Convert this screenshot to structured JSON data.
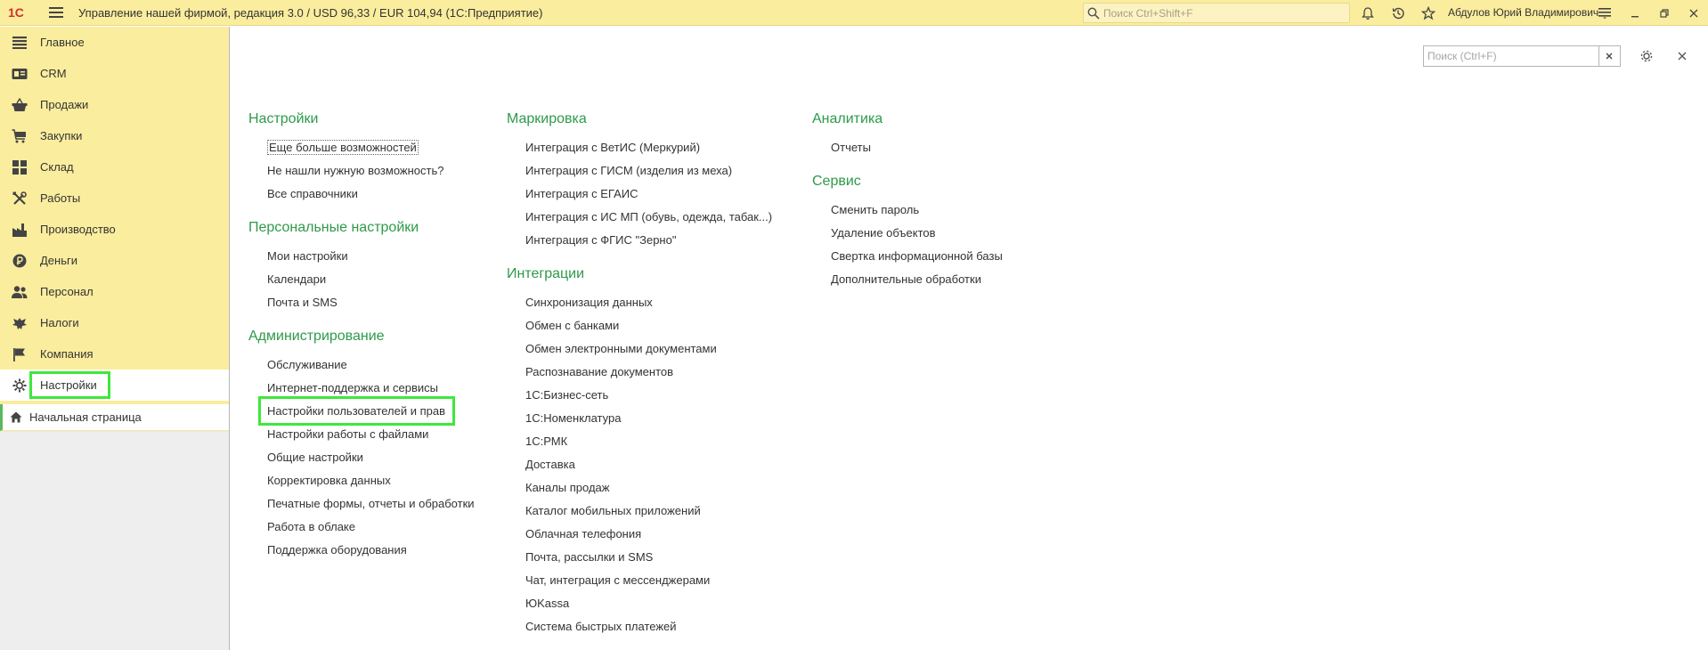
{
  "titlebar": {
    "logo_text": "1С",
    "title": "Управление нашей фирмой, редакция 3.0 / USD 96,33 / EUR 104,94  (1С:Предприятие)",
    "search_placeholder": "Поиск Ctrl+Shift+F",
    "user_name": "Абдулов Юрий Владимирович",
    "icons": [
      "bell-icon",
      "history-icon",
      "star-icon",
      "menu-icon",
      "minimize-icon",
      "restore-icon",
      "close-icon"
    ]
  },
  "sidebar": {
    "items": [
      {
        "label": "Главное",
        "icon": "home-list-icon"
      },
      {
        "label": "CRM",
        "icon": "crm-icon"
      },
      {
        "label": "Продажи",
        "icon": "basket-icon"
      },
      {
        "label": "Закупки",
        "icon": "cart-icon"
      },
      {
        "label": "Склад",
        "icon": "warehouse-icon"
      },
      {
        "label": "Работы",
        "icon": "tools-icon"
      },
      {
        "label": "Производство",
        "icon": "factory-icon"
      },
      {
        "label": "Деньги",
        "icon": "ruble-icon"
      },
      {
        "label": "Персонал",
        "icon": "people-icon"
      },
      {
        "label": "Налоги",
        "icon": "emblem-icon"
      },
      {
        "label": "Компания",
        "icon": "flag-icon"
      },
      {
        "label": "Настройки",
        "icon": "gear-icon",
        "active": true
      }
    ],
    "home_tab": "Начальная страница"
  },
  "main": {
    "search_placeholder": "Поиск (Ctrl+F)",
    "columns": [
      {
        "sections": [
          {
            "title": "Настройки",
            "links": [
              "Еще больше возможностей",
              "Не нашли нужную возможность?",
              "Все справочники"
            ]
          },
          {
            "title": "Персональные настройки",
            "links": [
              "Мои настройки",
              "Календари",
              "Почта и SMS"
            ]
          },
          {
            "title": "Администрирование",
            "links": [
              "Обслуживание",
              "Интернет-поддержка и сервисы",
              "Настройки пользователей и прав",
              "Настройки работы с файлами",
              "Общие настройки",
              "Корректировка данных",
              "Печатные формы, отчеты и обработки",
              "Работа в облаке",
              "Поддержка оборудования"
            ]
          }
        ]
      },
      {
        "sections": [
          {
            "title": "Маркировка",
            "links": [
              "Интеграция с ВетИС (Меркурий)",
              "Интеграция с ГИСМ (изделия из меха)",
              "Интеграция с ЕГАИС",
              "Интеграция с ИС МП (обувь, одежда, табак...)",
              "Интеграция с ФГИС \"Зерно\""
            ]
          },
          {
            "title": "Интеграции",
            "links": [
              "Синхронизация данных",
              "Обмен с банками",
              "Обмен электронными документами",
              "Распознавание документов",
              "1С:Бизнес-сеть",
              "1С:Номенклатура",
              "1С:РМК",
              "Доставка",
              "Каналы продаж",
              "Каталог мобильных приложений",
              "Облачная телефония",
              "Почта, рассылки и SMS",
              "Чат, интеграция с мессенджерами",
              "ЮKassa",
              "Система быстрых платежей"
            ]
          }
        ]
      },
      {
        "sections": [
          {
            "title": "Аналитика",
            "links": [
              "Отчеты"
            ]
          },
          {
            "title": "Сервис",
            "links": [
              "Сменить пароль",
              "Удаление объектов",
              "Свертка информационной базы",
              "Дополнительные обработки"
            ]
          }
        ]
      }
    ]
  }
}
